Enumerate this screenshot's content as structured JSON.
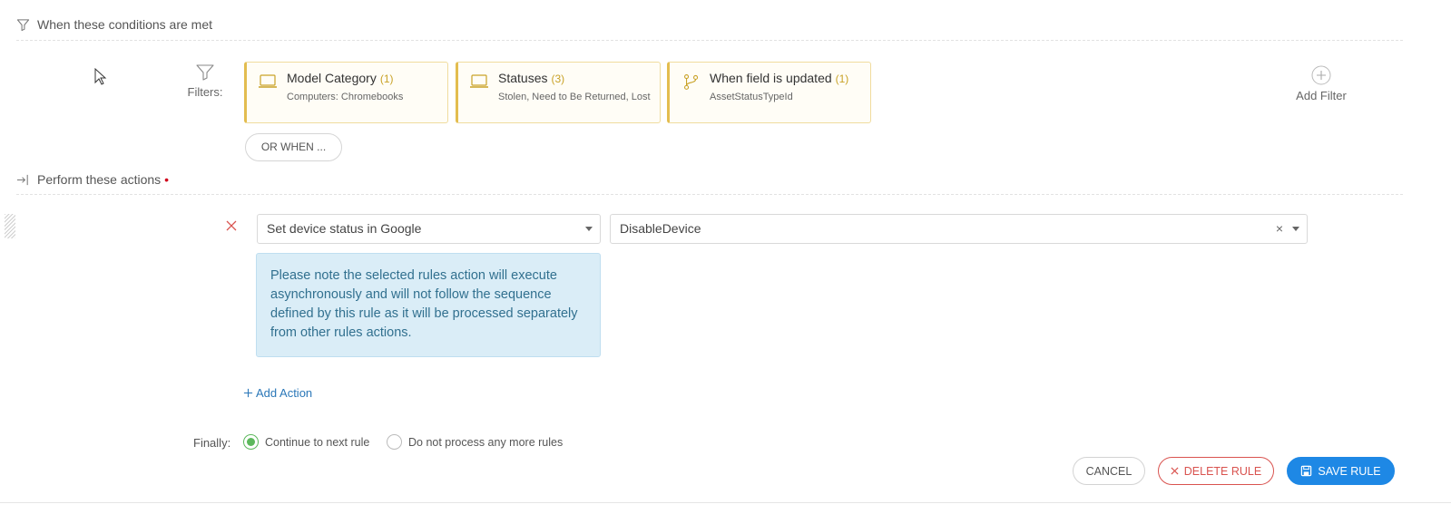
{
  "conditions": {
    "header": "When these conditions are met",
    "filters_label": "Filters:",
    "filters": [
      {
        "title": "Model Category",
        "count": "(1)",
        "desc": "Computers: Chromebooks",
        "icon": "laptop-icon"
      },
      {
        "title": "Statuses",
        "count": "(3)",
        "desc": "Stolen, Need to Be Returned, Lost",
        "icon": "laptop-icon"
      },
      {
        "title": "When field is updated",
        "count": "(1)",
        "desc": "AssetStatusTypeId",
        "icon": "branch-icon"
      }
    ],
    "add_filter_label": "Add Filter",
    "or_when_label": "OR WHEN ..."
  },
  "actions": {
    "header": "Perform these actions",
    "required_marker": "•",
    "action_select": "Set device status in Google",
    "value_select": "DisableDevice",
    "clear_symbol": "×",
    "info": "Please note the selected rules action will execute asynchronously and will not follow the sequence defined by this rule as it will be processed separately from other rules actions.",
    "add_action_label": "Add Action"
  },
  "finally": {
    "label": "Finally:",
    "options": [
      {
        "label": "Continue to next rule",
        "checked": true
      },
      {
        "label": "Do not process any more rules",
        "checked": false
      }
    ]
  },
  "buttons": {
    "cancel": "CANCEL",
    "delete": "DELETE RULE",
    "save": "SAVE RULE"
  },
  "colors": {
    "accent": "#1e88e5",
    "danger": "#d9534f",
    "success": "#5cb85c",
    "filter_border": "#e3bd4f",
    "info_bg": "#daedf7",
    "info_text": "#31708f"
  }
}
